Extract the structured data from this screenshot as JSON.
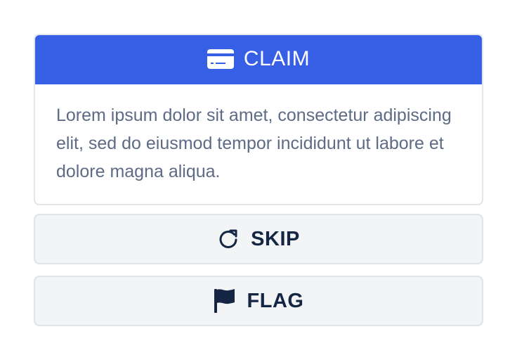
{
  "card": {
    "header_label": "CLAIM",
    "header_icon": "credit-card-icon",
    "body_text": "Lorem ipsum dolor sit amet, consectetur adipiscing elit, sed do eiusmod tempor incididunt ut labore et dolore magna aliqua."
  },
  "actions": {
    "skip_label": "SKIP",
    "skip_icon": "rotate-right-icon",
    "flag_label": "FLAG",
    "flag_icon": "flag-icon"
  },
  "colors": {
    "accent": "#375fe6",
    "text_dark": "#152544",
    "text_muted": "#5d6b86",
    "button_bg": "#f3f4f6",
    "border": "#e1e3e8"
  }
}
